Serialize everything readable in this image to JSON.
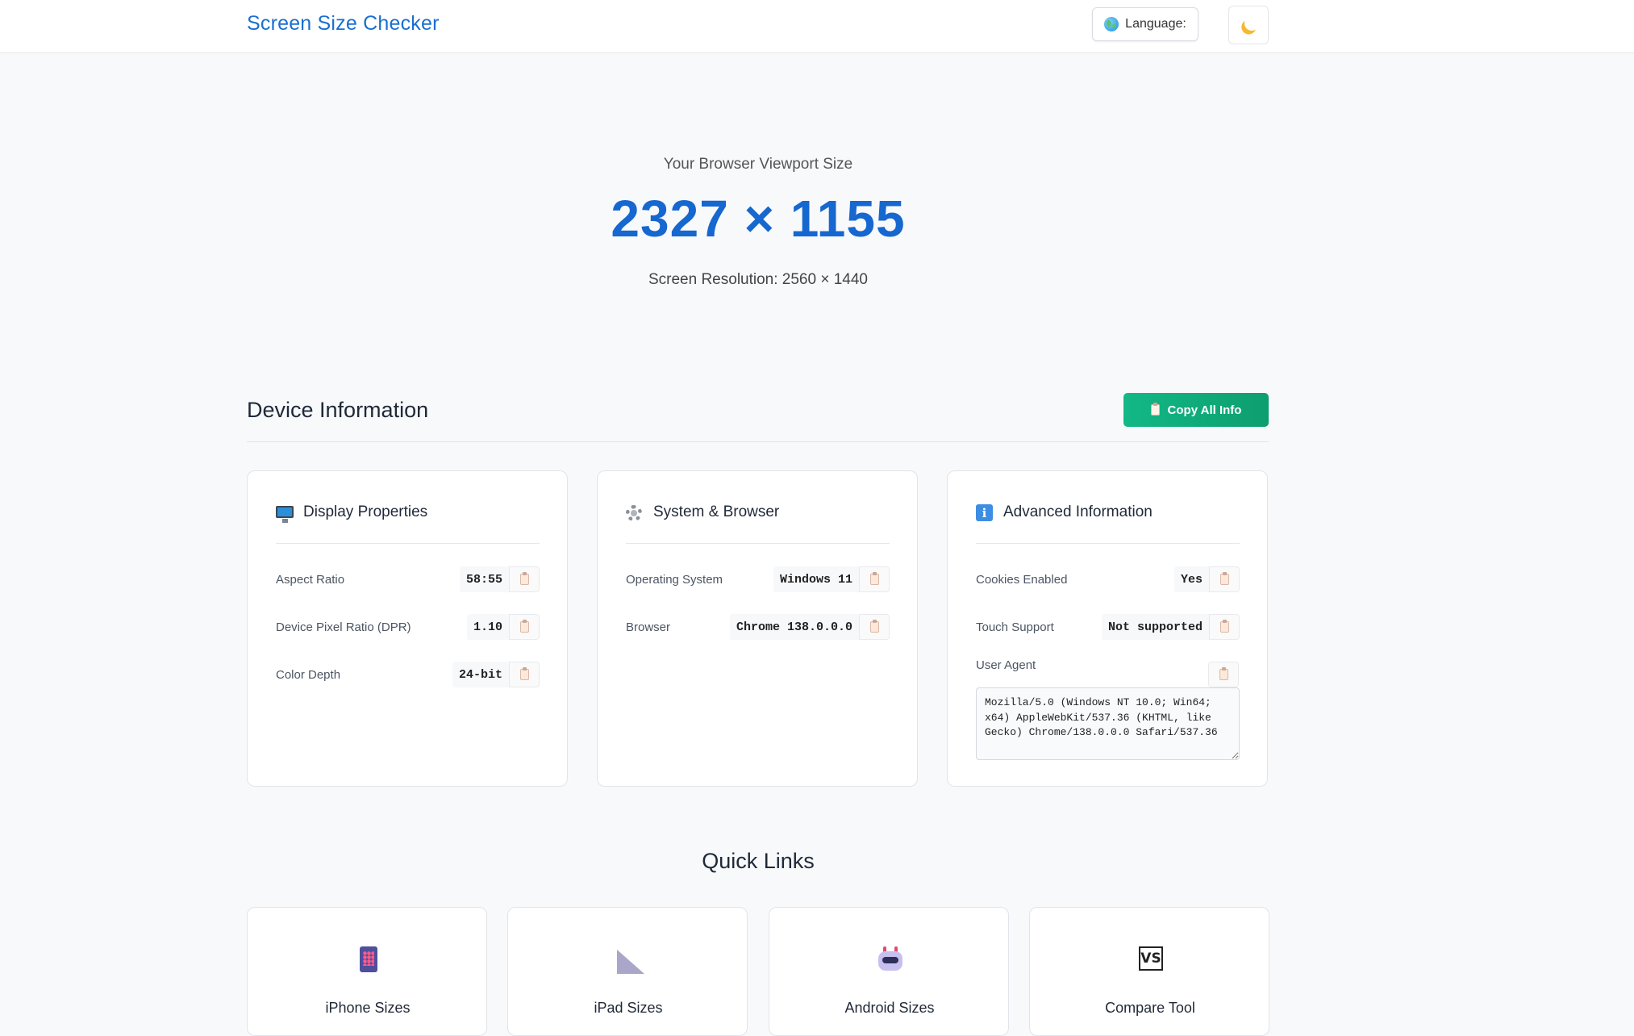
{
  "header": {
    "brand": "Screen Size Checker",
    "language_label": "Language:",
    "theme_icon": "moon-icon"
  },
  "hero": {
    "label": "Your Browser Viewport Size",
    "viewport": "2327 × 1155",
    "resolution": "Screen Resolution: 2560 × 1440"
  },
  "device_info": {
    "title": "Device Information",
    "copy_all_label": "Copy All Info",
    "cards": {
      "display": {
        "title": "Display Properties",
        "icon": "monitor-icon",
        "rows": [
          {
            "label": "Aspect Ratio",
            "value": "58:55"
          },
          {
            "label": "Device Pixel Ratio (DPR)",
            "value": "1.10"
          },
          {
            "label": "Color Depth",
            "value": "24-bit"
          }
        ]
      },
      "system": {
        "title": "System & Browser",
        "icon": "gear-icon",
        "rows": [
          {
            "label": "Operating System",
            "value": "Windows 11"
          },
          {
            "label": "Browser",
            "value": "Chrome 138.0.0.0"
          }
        ]
      },
      "advanced": {
        "title": "Advanced Information",
        "icon": "info-icon",
        "rows": [
          {
            "label": "Cookies Enabled",
            "value": "Yes"
          },
          {
            "label": "Touch Support",
            "value": "Not supported"
          }
        ],
        "user_agent_label": "User Agent",
        "user_agent": "Mozilla/5.0 (Windows NT 10.0; Win64; x64) AppleWebKit/537.36 (KHTML, like Gecko) Chrome/138.0.0.0 Safari/537.36"
      }
    }
  },
  "quick_links": {
    "title": "Quick Links",
    "items": [
      {
        "label": "iPhone Sizes",
        "icon": "phone-icon"
      },
      {
        "label": "iPad Sizes",
        "icon": "ruler-icon"
      },
      {
        "label": "Android Sizes",
        "icon": "android-icon"
      },
      {
        "label": "Compare Tool",
        "icon": "vs-icon"
      }
    ]
  },
  "colors": {
    "brand_blue": "#1a6fd0",
    "hero_blue": "#1667cf",
    "copy_green": "#12b886"
  }
}
